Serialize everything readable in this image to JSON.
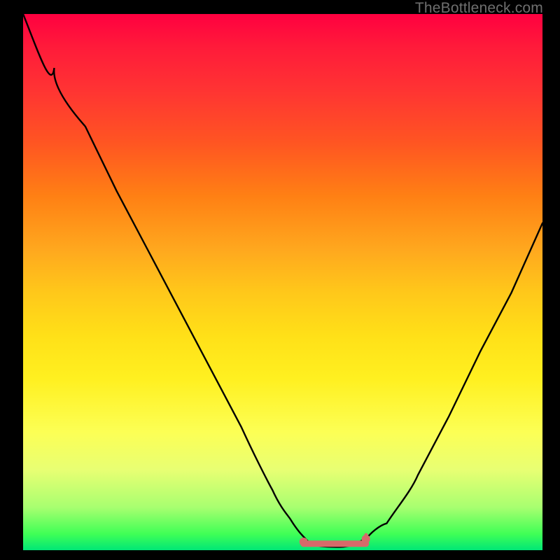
{
  "watermark": "TheBottleneck.com",
  "chart_data": {
    "type": "line",
    "title": "",
    "xlabel": "",
    "ylabel": "",
    "xlim": [
      0,
      100
    ],
    "ylim": [
      0,
      100
    ],
    "grid": false,
    "series": [
      {
        "name": "bottleneck-curve",
        "color": "#000000",
        "x": [
          0,
          6,
          12,
          18,
          24,
          30,
          36,
          42,
          47,
          51,
          54,
          56,
          58,
          60,
          62,
          64,
          66,
          70,
          76,
          82,
          88,
          94,
          100
        ],
        "y": [
          100,
          90,
          79,
          67,
          56,
          45,
          34,
          23,
          13,
          6.5,
          3,
          1.5,
          0.8,
          0.6,
          0.6,
          0.8,
          1.5,
          5,
          14,
          25,
          37,
          49,
          61
        ]
      },
      {
        "name": "sweet-spot-marker",
        "color": "#d66a6a",
        "type": "segment",
        "x": [
          54,
          66
        ],
        "y": [
          1.2,
          1.2
        ]
      }
    ],
    "annotations": []
  },
  "colors": {
    "background": "#000000",
    "gradient_top": "#ff0040",
    "gradient_bottom": "#00e676",
    "curve": "#000000",
    "sweet_spot": "#d66a6a",
    "watermark": "#6f6f6f"
  }
}
